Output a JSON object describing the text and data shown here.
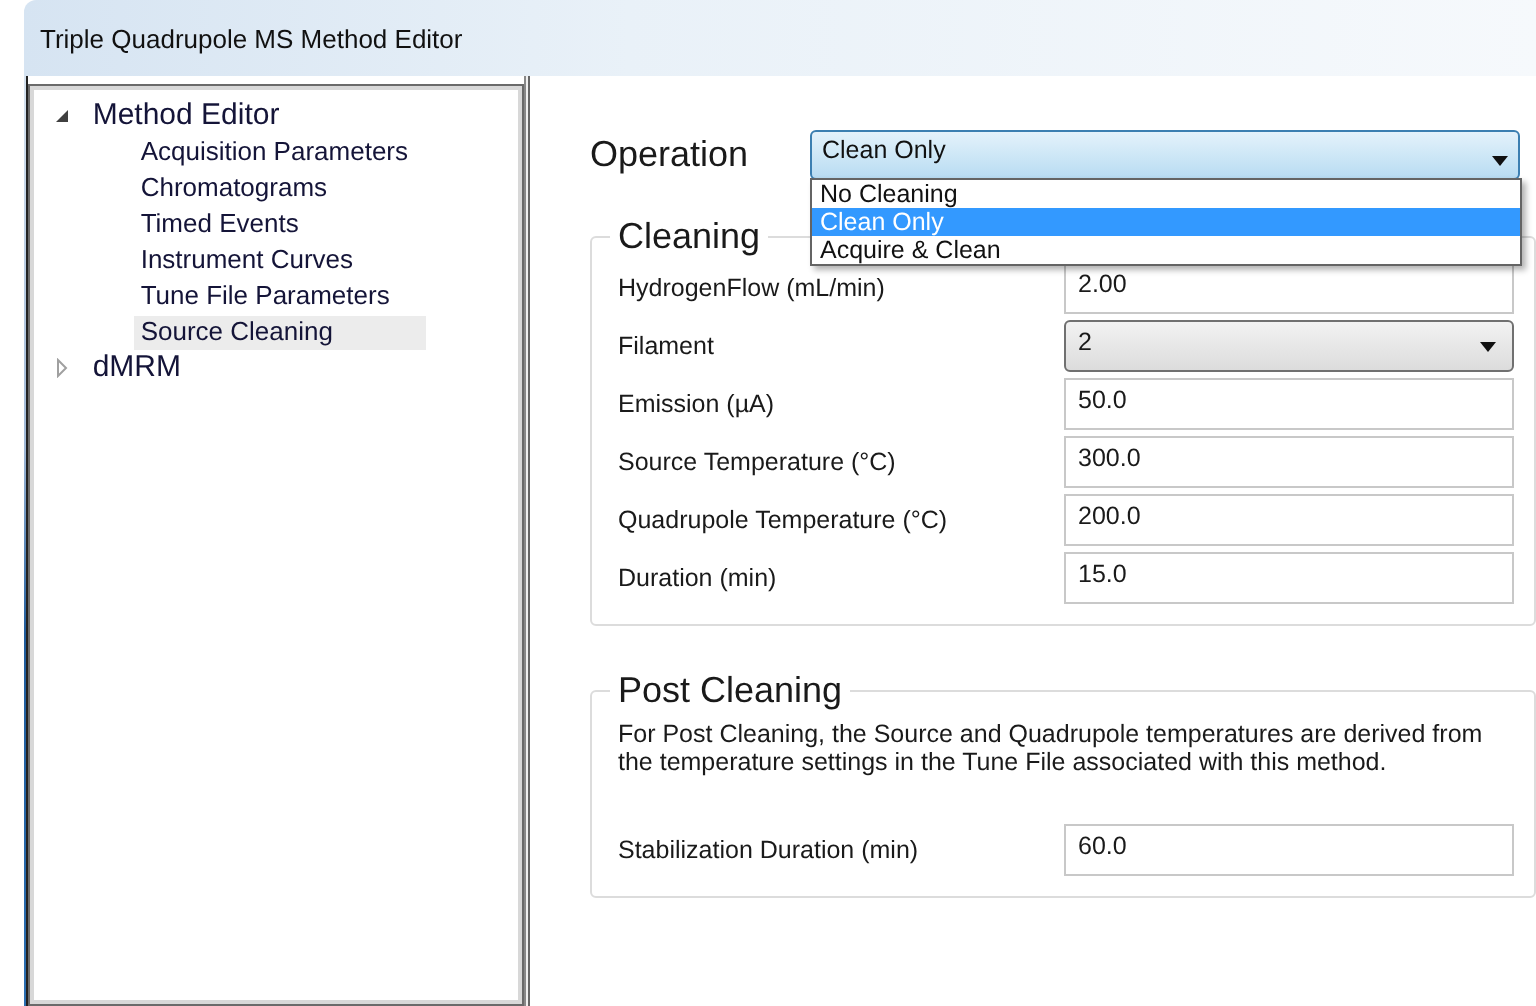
{
  "window": {
    "title": "Triple Quadrupole MS Method Editor"
  },
  "tree": [
    {
      "label": "Method Editor",
      "expanded": true,
      "selected": false,
      "children": [
        {
          "label": "Acquisition Parameters",
          "selected": false
        },
        {
          "label": "Chromatograms",
          "selected": false
        },
        {
          "label": "Timed Events",
          "selected": false
        },
        {
          "label": "Instrument Curves",
          "selected": false
        },
        {
          "label": "Tune File Parameters",
          "selected": false
        },
        {
          "label": "Source Cleaning",
          "selected": true
        }
      ]
    },
    {
      "label": "dMRM",
      "expanded": false,
      "selected": false
    }
  ],
  "operation": {
    "label": "Operation",
    "value": "Clean Only",
    "expanded": true,
    "options": [
      {
        "label": "No Cleaning",
        "selected": false
      },
      {
        "label": "Clean Only",
        "selected": true
      },
      {
        "label": "Acquire & Clean",
        "selected": false
      }
    ]
  },
  "cleaning": {
    "title": "Cleaning",
    "fields": [
      {
        "label": "HydrogenFlow (mL/min)",
        "value": "2.00",
        "kind": "text"
      },
      {
        "label": "Filament",
        "value": "2",
        "kind": "dropdown"
      },
      {
        "label": "Emission (µA)",
        "value": "50.0",
        "kind": "text"
      },
      {
        "label": "Source Temperature (°C)",
        "value": "300.0",
        "kind": "text"
      },
      {
        "label": "Quadrupole Temperature (°C)",
        "value": "200.0",
        "kind": "text"
      },
      {
        "label": "Duration (min)",
        "value": "15.0",
        "kind": "text"
      }
    ]
  },
  "post_cleaning": {
    "title": "Post Cleaning",
    "note": "For Post Cleaning, the Source and Quadrupole temperatures are derived from the temperature settings in the Tune File associated with this method.",
    "fields": [
      {
        "label": "Stabilization Duration (min)",
        "value": "60.0",
        "kind": "text"
      }
    ]
  }
}
